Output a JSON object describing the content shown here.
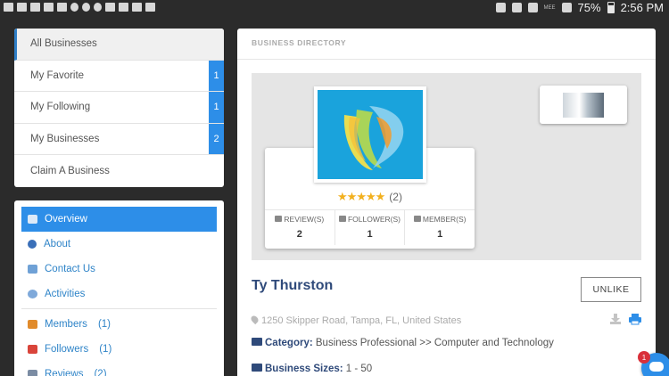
{
  "status_bar": {
    "battery": "75%",
    "time": "2:56 PM",
    "network": "MEE",
    "left_icons": [
      "facebook-icon",
      "mail-icon",
      "gmail-icon",
      "email-icon",
      "image-icon",
      "pinwheel-icon",
      "instagram-icon",
      "location-icon",
      "message-icon",
      "check-icon",
      "check-icon",
      "check-icon"
    ],
    "right_icons": [
      "bluetooth-icon",
      "mute-icon",
      "alarm-icon",
      "wifi-icon",
      "signal-icon",
      "battery-icon"
    ]
  },
  "sidebar": {
    "items": [
      {
        "label": "All Businesses",
        "badge": ""
      },
      {
        "label": "My Favorite",
        "badge": "1"
      },
      {
        "label": "My Following",
        "badge": "1"
      },
      {
        "label": "My Businesses",
        "badge": "2"
      },
      {
        "label": "Claim A Business",
        "badge": ""
      }
    ]
  },
  "menu": {
    "items": [
      {
        "label": "Overview",
        "count": "",
        "icon": "overview-icon",
        "color": "#ffffff"
      },
      {
        "label": "About",
        "count": "",
        "icon": "info-icon",
        "color": "#3a6fb8"
      },
      {
        "label": "Contact Us",
        "count": "",
        "icon": "envelope-icon",
        "color": "#6fa1d6"
      },
      {
        "label": "Activities",
        "count": "",
        "icon": "comment-icon",
        "color": "#7fa9da"
      },
      {
        "label": "Members",
        "count": "(1)",
        "icon": "members-icon",
        "color": "#e18b2b"
      },
      {
        "label": "Followers",
        "count": "(1)",
        "icon": "followers-icon",
        "color": "#d9443a"
      },
      {
        "label": "Reviews",
        "count": "(2)",
        "icon": "reviews-icon",
        "color": "#7b8ca3"
      }
    ]
  },
  "directory": {
    "title": "BUSINESS DIRECTORY",
    "rating_count": "(2)",
    "stars": "★★★★★",
    "stats": [
      {
        "label": "REVIEW(S)",
        "value": "2",
        "icon": "edit-icon"
      },
      {
        "label": "FOLLOWER(S)",
        "value": "1",
        "icon": "arrow-right-icon"
      },
      {
        "label": "MEMBER(S)",
        "value": "1",
        "icon": "users-icon"
      }
    ],
    "business_name": "Ty Thurston",
    "unlike_label": "UNLIKE",
    "address": "1250 Skipper Road, Tampa, FL, United States",
    "category_label": "Category:",
    "category_value": "Business Professional >> Computer and Technology",
    "sizes_label": "Business Sizes:",
    "sizes_value": "1 - 50"
  },
  "chat": {
    "badge": "1"
  },
  "colors": {
    "accent": "#2d8ee8",
    "title": "#2f4a7a",
    "star": "#f2b01e"
  }
}
